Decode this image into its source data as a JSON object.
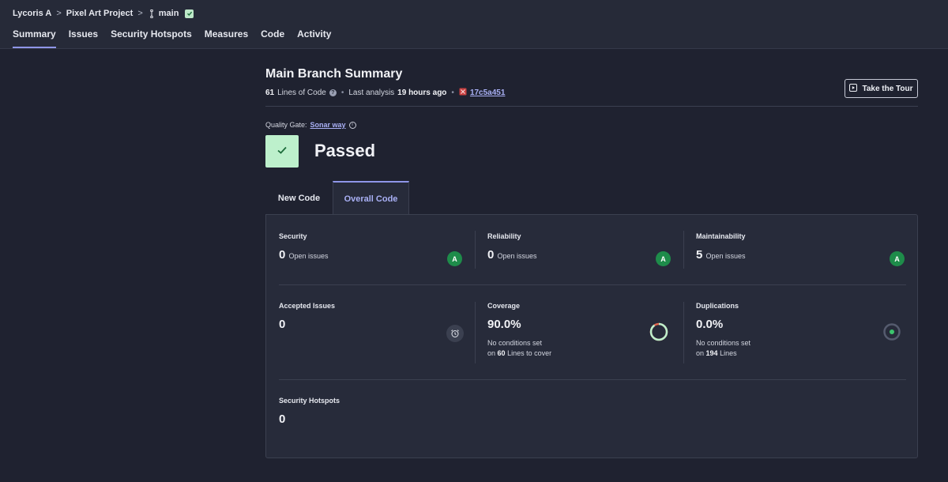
{
  "breadcrumb": {
    "org": "Lycoris A",
    "project": "Pixel Art Project",
    "branch": "main"
  },
  "nav": {
    "items": [
      "Summary",
      "Issues",
      "Security Hotspots",
      "Measures",
      "Code",
      "Activity"
    ],
    "active": "Summary"
  },
  "header": {
    "title": "Main Branch Summary",
    "lines_count": "61",
    "lines_label": "Lines of Code",
    "last_analysis_label": "Last analysis",
    "last_analysis_value": "19 hours ago",
    "commit": "17c5a451",
    "tour_button": "Take the Tour"
  },
  "quality_gate": {
    "label": "Quality Gate:",
    "name": "Sonar way",
    "status": "Passed"
  },
  "tabs": {
    "new_code": "New Code",
    "overall_code": "Overall Code",
    "active": "Overall Code"
  },
  "metrics": {
    "security": {
      "title": "Security",
      "value": "0",
      "sub": "Open issues",
      "rating": "A"
    },
    "reliability": {
      "title": "Reliability",
      "value": "0",
      "sub": "Open issues",
      "rating": "A"
    },
    "maintainability": {
      "title": "Maintainability",
      "value": "5",
      "sub": "Open issues",
      "rating": "A"
    },
    "accepted": {
      "title": "Accepted Issues",
      "value": "0"
    },
    "coverage": {
      "title": "Coverage",
      "value": "90.0%",
      "note_line1": "No conditions set",
      "note_prefix": "on",
      "note_count": "60",
      "note_suffix": "Lines to cover",
      "percent": 90
    },
    "duplications": {
      "title": "Duplications",
      "value": "0.0%",
      "note_line1": "No conditions set",
      "note_prefix": "on",
      "note_count": "194",
      "note_suffix": "Lines",
      "percent": 0
    },
    "hotspots": {
      "title": "Security Hotspots",
      "value": "0"
    }
  },
  "colors": {
    "accent": "#8f96e8",
    "rating_a": "#1e8c4a",
    "passed": "#bdf0cc",
    "coverage_ring": "#bdf0cc",
    "coverage_uncovered": "#e0674f"
  }
}
